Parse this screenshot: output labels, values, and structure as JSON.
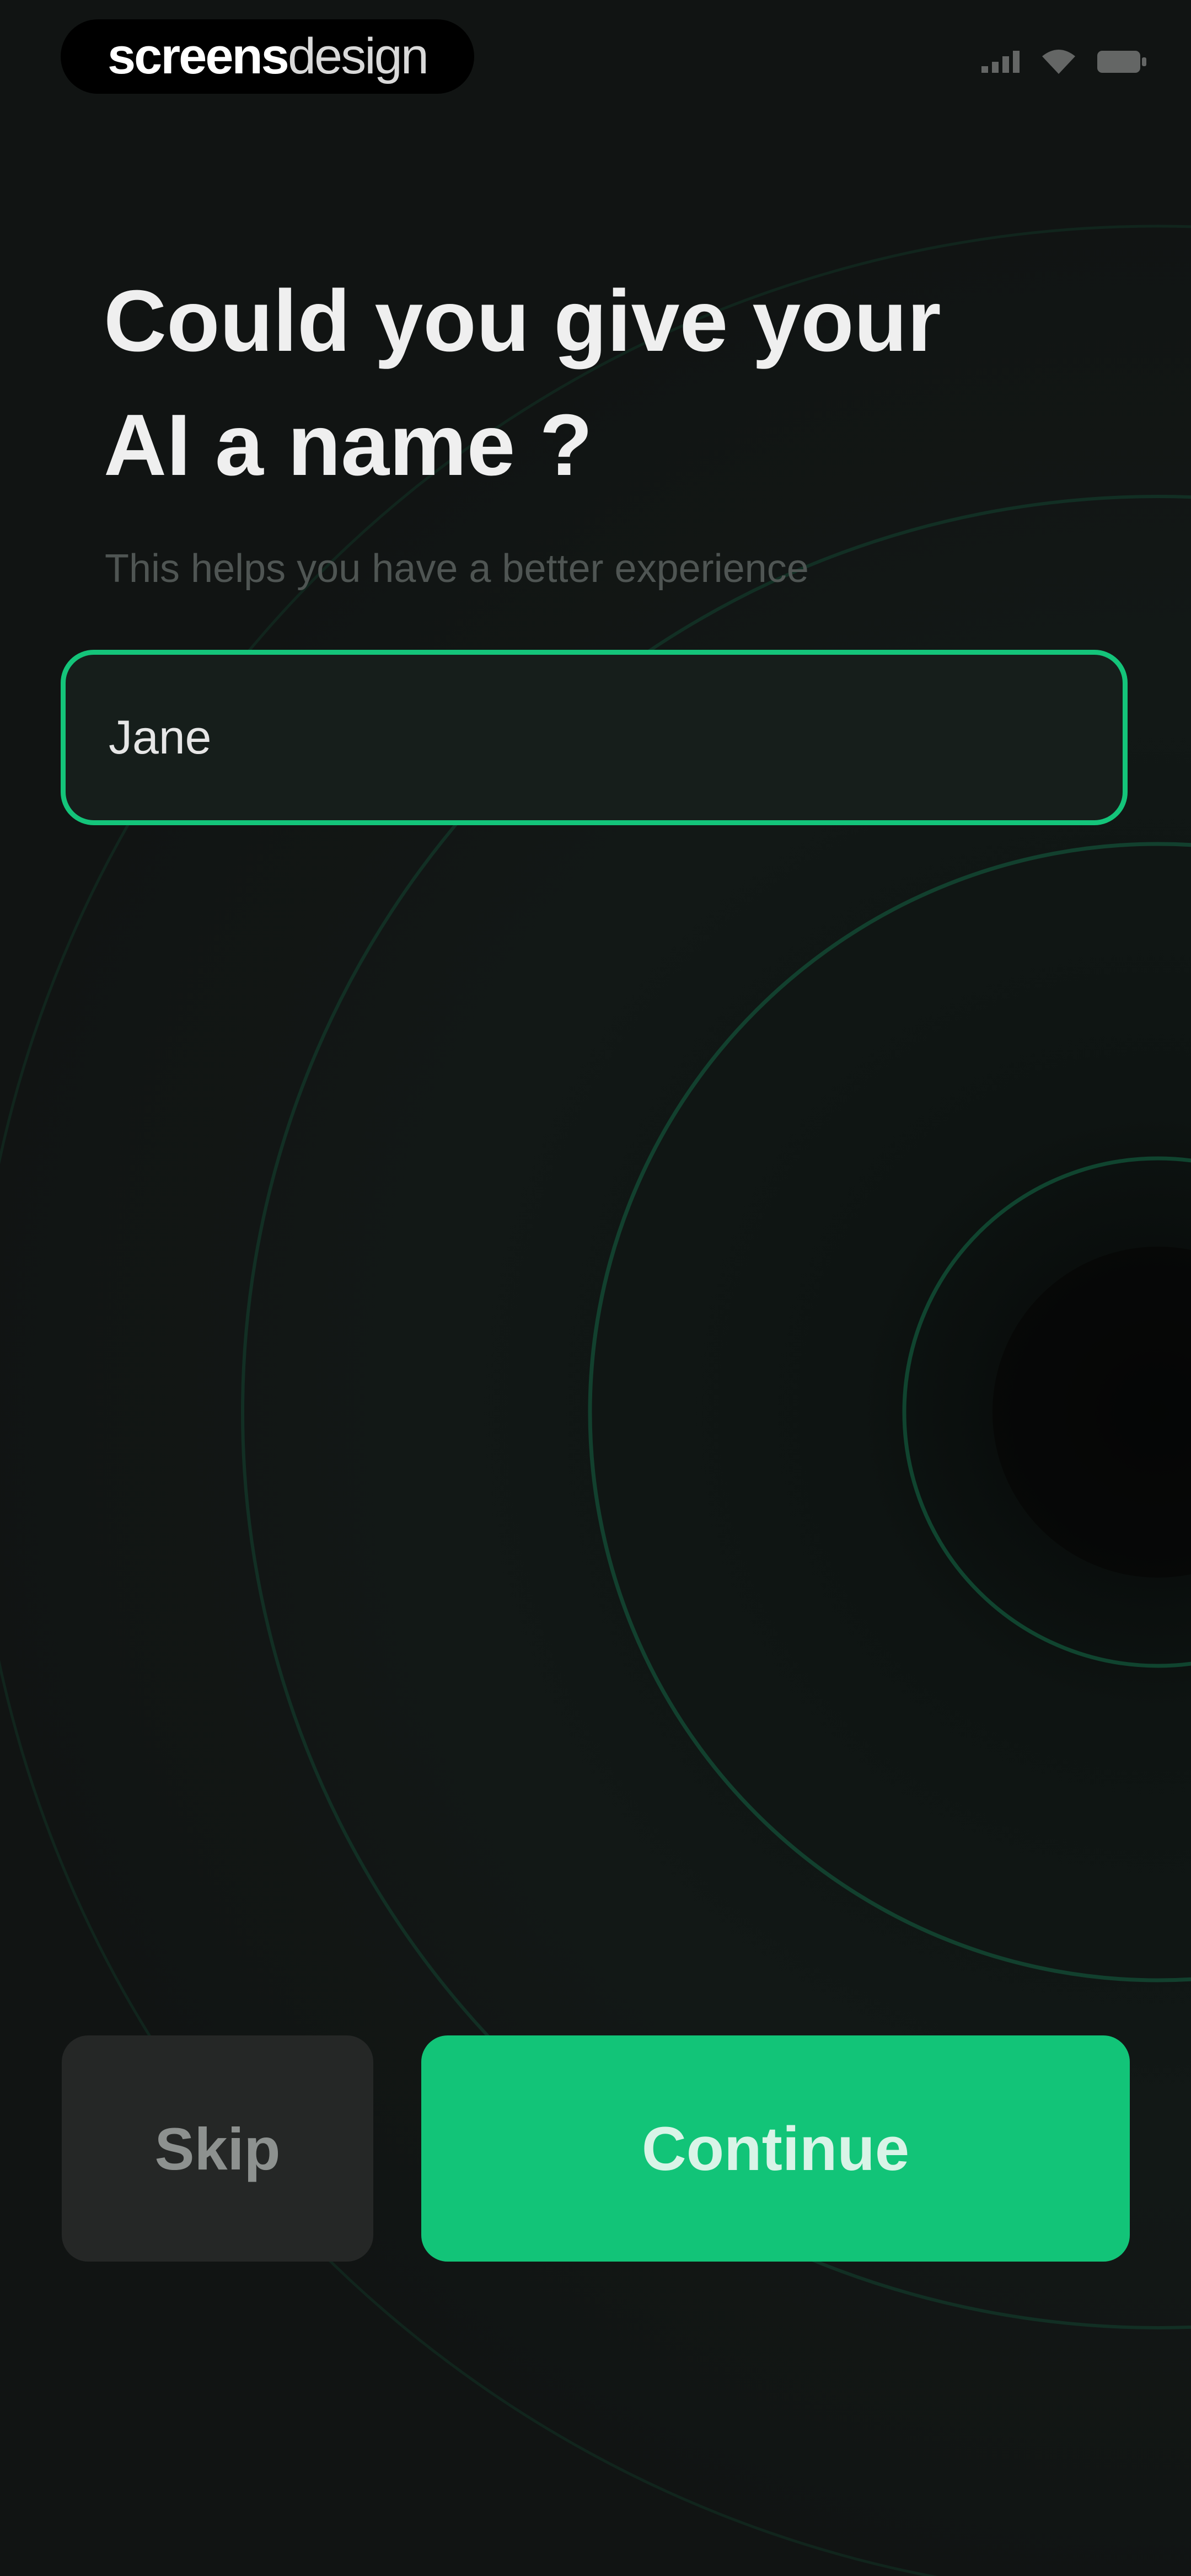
{
  "brand": {
    "bold": "screens",
    "light": "design"
  },
  "status_bar": {
    "icons": [
      "signal-icon",
      "wifi-icon",
      "battery-icon"
    ]
  },
  "onboarding": {
    "title_line1": "Could you give your",
    "title_line2": "AI a name ?",
    "subtitle": "This helps you have a better experience",
    "name_value": "Jane",
    "skip_label": "Skip",
    "continue_label": "Continue"
  },
  "colors": {
    "background": "#111413",
    "accent": "#12c478",
    "field_border": "#14c47a",
    "field_fill": "#161e1b",
    "skip_fill": "#252726"
  }
}
